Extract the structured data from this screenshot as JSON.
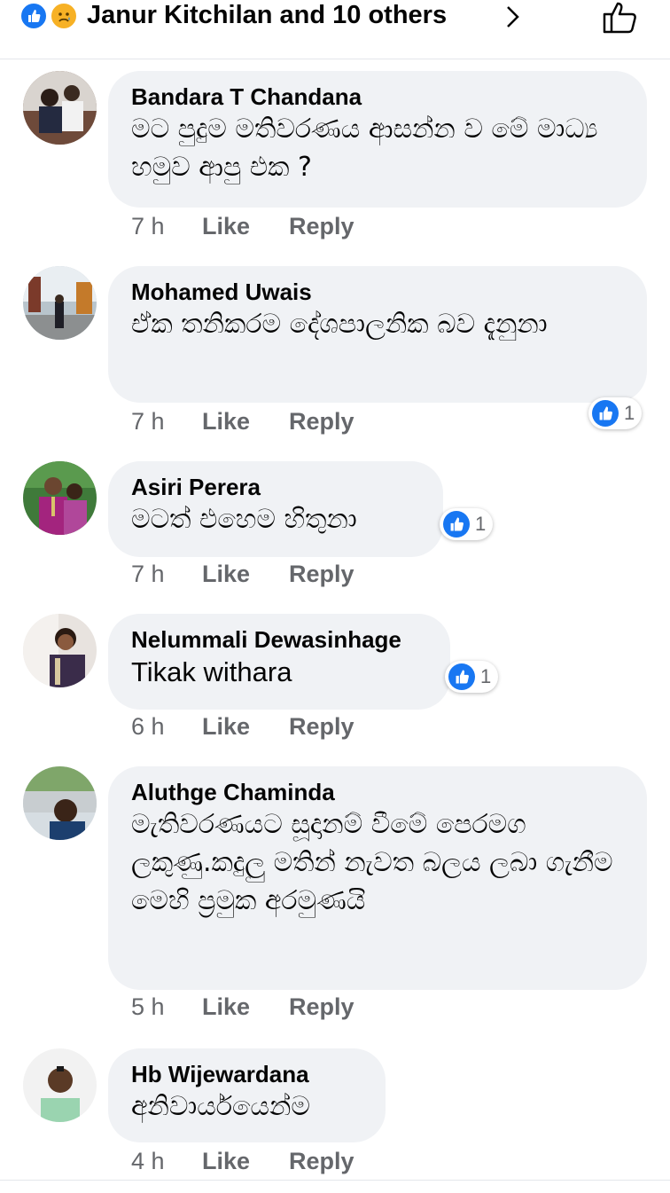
{
  "header": {
    "reactions_summary": "Janur Kitchilan and 10 others",
    "reaction_icons": [
      "like-icon",
      "sad-icon"
    ],
    "accent_color": "#1877f2"
  },
  "comments": [
    {
      "author": "Bandara T Chandana",
      "text": "මට පුදුම මතිවරණය ආසන්න ව මේ මාධ්‍ය හමුව ආපු එක ?",
      "time": "7 h",
      "like_label": "Like",
      "reply_label": "Reply"
    },
    {
      "author": "Mohamed Uwais",
      "text": "ඒක තනිකරම දේශපාලනික බව දැනුනා",
      "time": "7 h",
      "like_label": "Like",
      "reply_label": "Reply",
      "reaction_count": "1"
    },
    {
      "author": "Asiri Perera",
      "text": "මටත් එහෙම හිතුනා",
      "time": "7 h",
      "like_label": "Like",
      "reply_label": "Reply",
      "reaction_count": "1"
    },
    {
      "author": "Nelummali Dewasinhage",
      "text": "Tikak withara",
      "time": "6 h",
      "like_label": "Like",
      "reply_label": "Reply",
      "reaction_count": "1"
    },
    {
      "author": "Aluthge Chaminda",
      "text": "මැතිවරණයට සූදානම් වීමේ පෙරමග ලකුණු.කදුලු මතින් නැවත බලය ලබා ගැනීම මෙහි ප්‍රමුක අරමුණයි",
      "time": "5 h",
      "like_label": "Like",
      "reply_label": "Reply"
    },
    {
      "author": "Hb Wijewardana",
      "text": "අනිවාර්යයෙන්ම",
      "time": "4 h",
      "like_label": "Like",
      "reply_label": "Reply"
    }
  ]
}
